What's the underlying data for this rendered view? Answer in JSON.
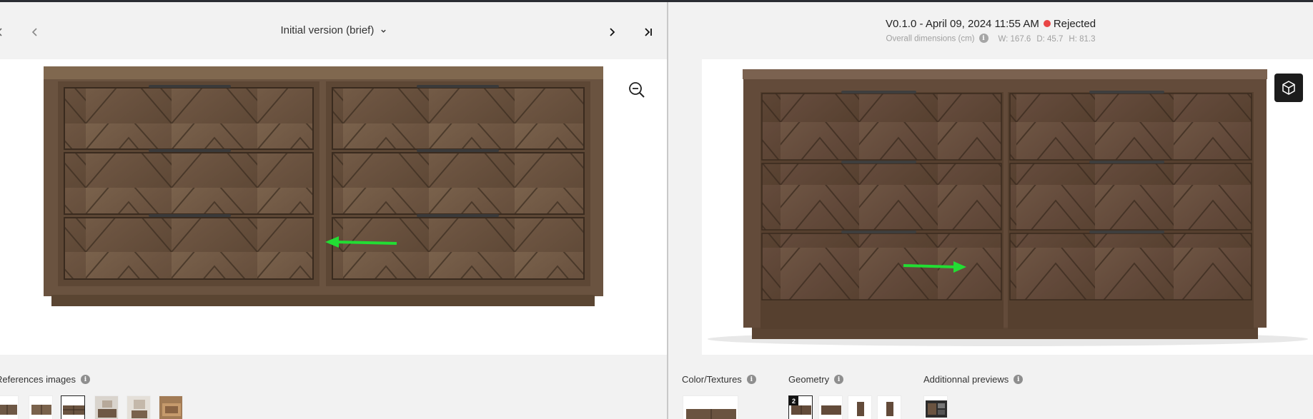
{
  "left_panel": {
    "version_label": "Initial version (brief)",
    "references_label": "References images",
    "reference_thumbs": [
      "dresser-front",
      "dresser-angle",
      "dresser-front-selected",
      "bedroom-set",
      "bedroom-mirror",
      "drawer-open"
    ],
    "selected_thumb_index": 2
  },
  "right_panel": {
    "version_text": "V0.1.0 - April 09, 2024 11:55 AM",
    "status_text": "Rejected",
    "status_color": "#e94545",
    "dimensions_label": "Overall dimensions (cm)",
    "width": "W: 167.6",
    "depth": "D: 45.7",
    "height": "H: 81.3",
    "color_textures_label": "Color/Textures",
    "geometry_label": "Geometry",
    "geometry_badge": "2",
    "additional_previews_label": "Additionnal previews"
  },
  "annotation_color": "#22dd33"
}
